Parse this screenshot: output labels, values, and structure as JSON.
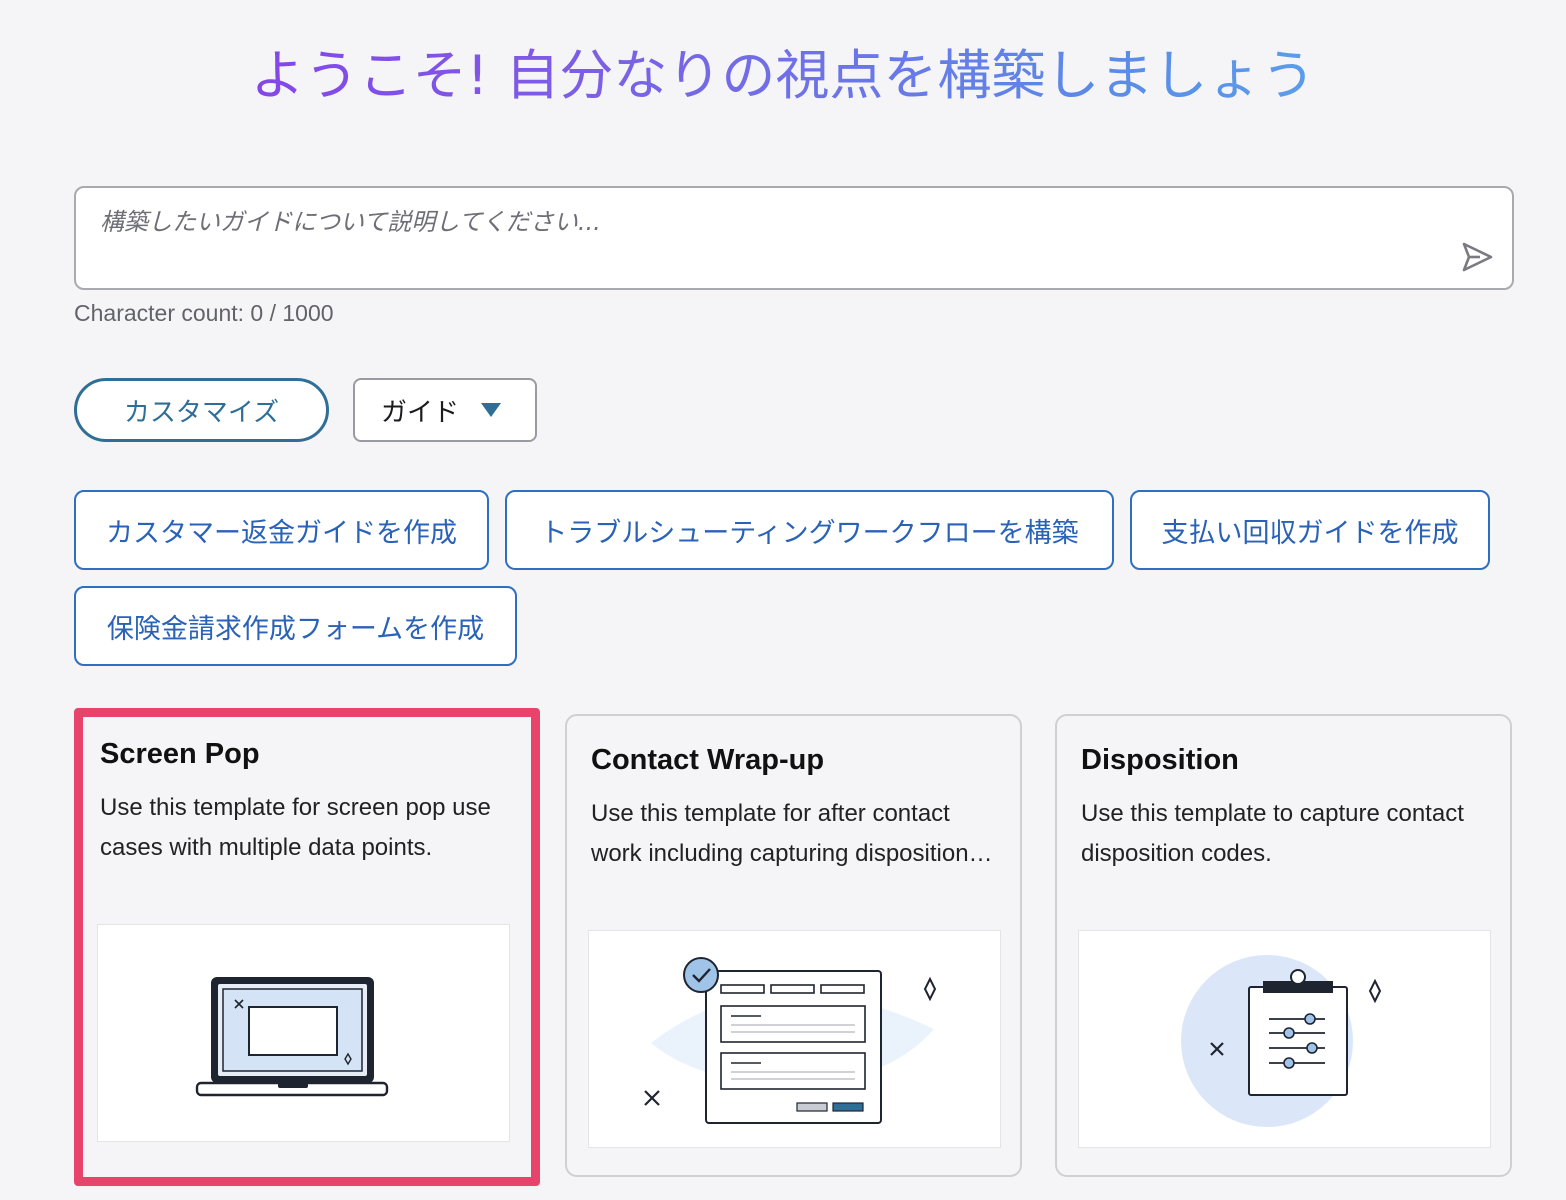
{
  "header": {
    "title": "ようこそ! 自分なりの視点を構築しましょう",
    "gradient": [
      "#8a33ea",
      "#5ab3ee"
    ]
  },
  "prompt": {
    "placeholder": "構築したいガイドについて説明してください...",
    "value": "",
    "char_count": "Character count: 0 / 1000",
    "send_icon": "send-icon"
  },
  "controls": {
    "customize_label": "カスタマイズ",
    "guide_select_value": "ガイド"
  },
  "suggestions": [
    {
      "label": "カスタマー返金ガイドを作成"
    },
    {
      "label": "トラブルシューティングワークフローを構築"
    },
    {
      "label": "支払い回収ガイドを作成"
    },
    {
      "label": "保険金請求作成フォームを作成"
    }
  ],
  "templates": [
    {
      "title": "Screen Pop",
      "description": "Use this template for screen pop use cases with multiple data points.",
      "icon": "laptop-icon",
      "selected": true
    },
    {
      "title": "Contact Wrap-up",
      "description": "Use this template for after contact work including capturing disposition codes.",
      "icon": "form-check-icon",
      "selected": false
    },
    {
      "title": "Disposition",
      "description": "Use this template to capture contact disposition codes.",
      "icon": "clipboard-icon",
      "selected": false
    }
  ],
  "colors": {
    "accent": "#2f6e96",
    "link": "#2a62b8",
    "selected_border": "#e8446b",
    "background": "#f5f5f7"
  }
}
